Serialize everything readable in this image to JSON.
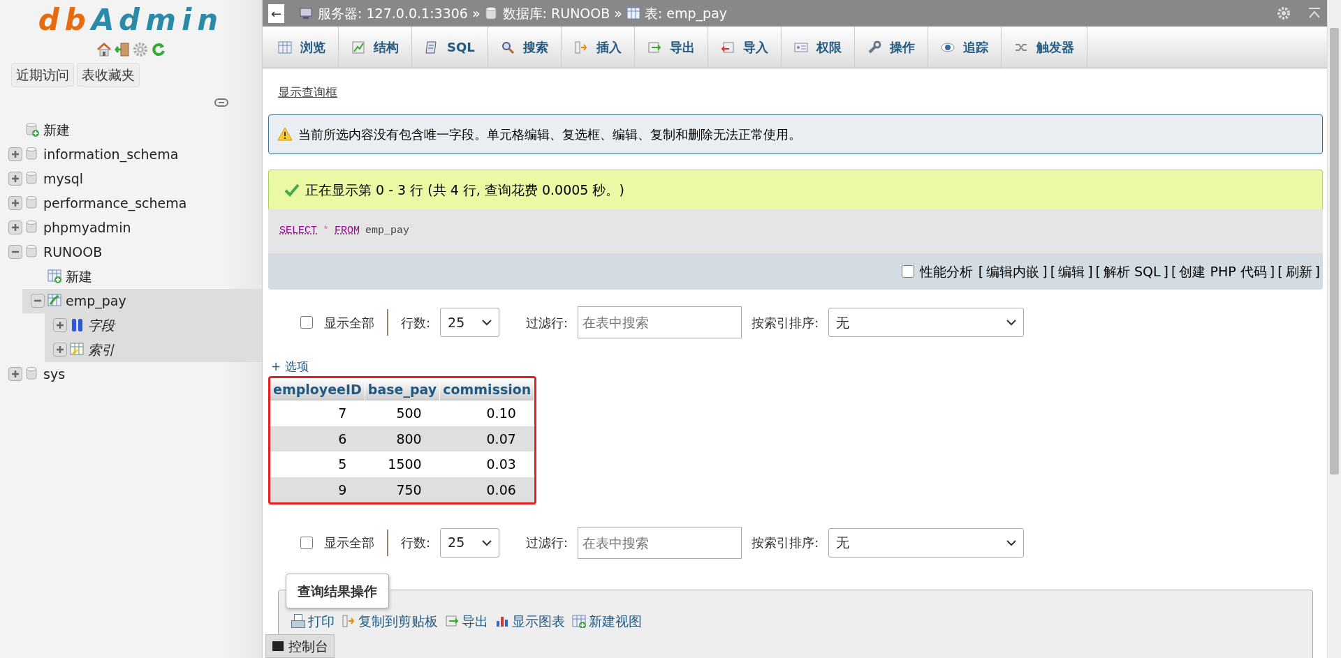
{
  "sidebar": {
    "logo": [
      "db",
      "Admin"
    ],
    "tabs": [
      {
        "label": "近期访问"
      },
      {
        "label": "表收藏夹"
      }
    ],
    "tree": [
      {
        "label": "新建",
        "kind": "new-db",
        "selected": false
      },
      {
        "label": "information_schema",
        "kind": "db",
        "expanded": false,
        "selected": false
      },
      {
        "label": "mysql",
        "kind": "db",
        "expanded": false,
        "selected": false
      },
      {
        "label": "performance_schema",
        "kind": "db",
        "expanded": false,
        "selected": false
      },
      {
        "label": "phpmyadmin",
        "kind": "db",
        "expanded": false,
        "selected": false
      },
      {
        "label": "RUNOOB",
        "kind": "db",
        "expanded": true,
        "selected": false,
        "children": [
          {
            "label": "新建",
            "kind": "new-table",
            "selected": false
          },
          {
            "label": "emp_pay",
            "kind": "table",
            "expanded": true,
            "selected": true,
            "children": [
              {
                "label": "字段",
                "kind": "columns",
                "expanded": false,
                "selected": true
              },
              {
                "label": "索引",
                "kind": "indexes",
                "expanded": false,
                "selected": true
              }
            ]
          }
        ]
      },
      {
        "label": "sys",
        "kind": "db",
        "expanded": false,
        "selected": false
      }
    ]
  },
  "breadcrumb": {
    "back": "←",
    "separator": "»",
    "items": [
      {
        "label": "服务器: 127.0.0.1:3306",
        "kind": "server"
      },
      {
        "label": "数据库: RUNOOB",
        "kind": "database"
      },
      {
        "label": "表: emp_pay",
        "kind": "table"
      }
    ]
  },
  "tabs": [
    {
      "label": "浏览",
      "kind": "browse",
      "selected": false
    },
    {
      "label": "结构",
      "kind": "structure",
      "selected": false
    },
    {
      "label": "SQL",
      "kind": "sql",
      "selected": false
    },
    {
      "label": "搜索",
      "kind": "search",
      "selected": false
    },
    {
      "label": "插入",
      "kind": "insert",
      "selected": false
    },
    {
      "label": "导出",
      "kind": "export",
      "selected": false
    },
    {
      "label": "导入",
      "kind": "import",
      "selected": false
    },
    {
      "label": "权限",
      "kind": "privileges",
      "selected": false
    },
    {
      "label": "操作",
      "kind": "operations",
      "selected": false
    },
    {
      "label": "追踪",
      "kind": "tracking",
      "selected": false
    },
    {
      "label": "触发器",
      "kind": "triggers",
      "selected": false
    }
  ],
  "query_box_link": "显示查询框",
  "warning": "当前所选内容没有包含唯一字段。单元格编辑、复选框、编辑、复制和删除无法正常使用。",
  "success": "正在显示第 0 - 3 行 (共 4 行, 查询花费 0.0005 秒。)",
  "sql": [
    {
      "text": "SELECT",
      "kind": "keyword"
    },
    {
      "text": "*",
      "kind": "operator"
    },
    {
      "text": "FROM",
      "kind": "keyword"
    },
    {
      "text": "emp_pay",
      "kind": "plain"
    }
  ],
  "sql_tools": {
    "brackets": [
      "[",
      "]"
    ],
    "profiling": {
      "label": "性能分析",
      "checked": false
    },
    "links": [
      "编辑内嵌",
      "编辑",
      "解析 SQL",
      "创建 PHP 代码",
      "刷新"
    ]
  },
  "navigation": [
    {
      "show_all": {
        "label": "显示全部",
        "checked": false
      },
      "rows_label": "行数:",
      "rows_value": "25",
      "filter_label": "过滤行:",
      "filter_placeholder": "在表中搜索",
      "sort_label": "按索引排序:",
      "sort_value": "无"
    },
    {
      "show_all": {
        "label": "显示全部",
        "checked": false
      },
      "rows_label": "行数:",
      "rows_value": "25",
      "filter_label": "过滤行:",
      "filter_placeholder": "在表中搜索",
      "sort_label": "按索引排序:",
      "sort_value": "无"
    }
  ],
  "options_link": "+ 选项",
  "table": {
    "columns": [
      "employeeID",
      "base_pay",
      "commission"
    ],
    "rows": [
      [
        "7",
        "500",
        "0.10"
      ],
      [
        "6",
        "800",
        "0.07"
      ],
      [
        "5",
        "1500",
        "0.03"
      ],
      [
        "9",
        "750",
        "0.06"
      ]
    ]
  },
  "result_ops": {
    "title": "查询结果操作",
    "links": [
      {
        "label": "打印",
        "kind": "print"
      },
      {
        "label": "复制到剪贴板",
        "kind": "copy"
      },
      {
        "label": "导出",
        "kind": "export"
      },
      {
        "label": "显示图表",
        "kind": "chart"
      },
      {
        "label": "新建视图",
        "kind": "view"
      }
    ]
  },
  "console": "控制台"
}
